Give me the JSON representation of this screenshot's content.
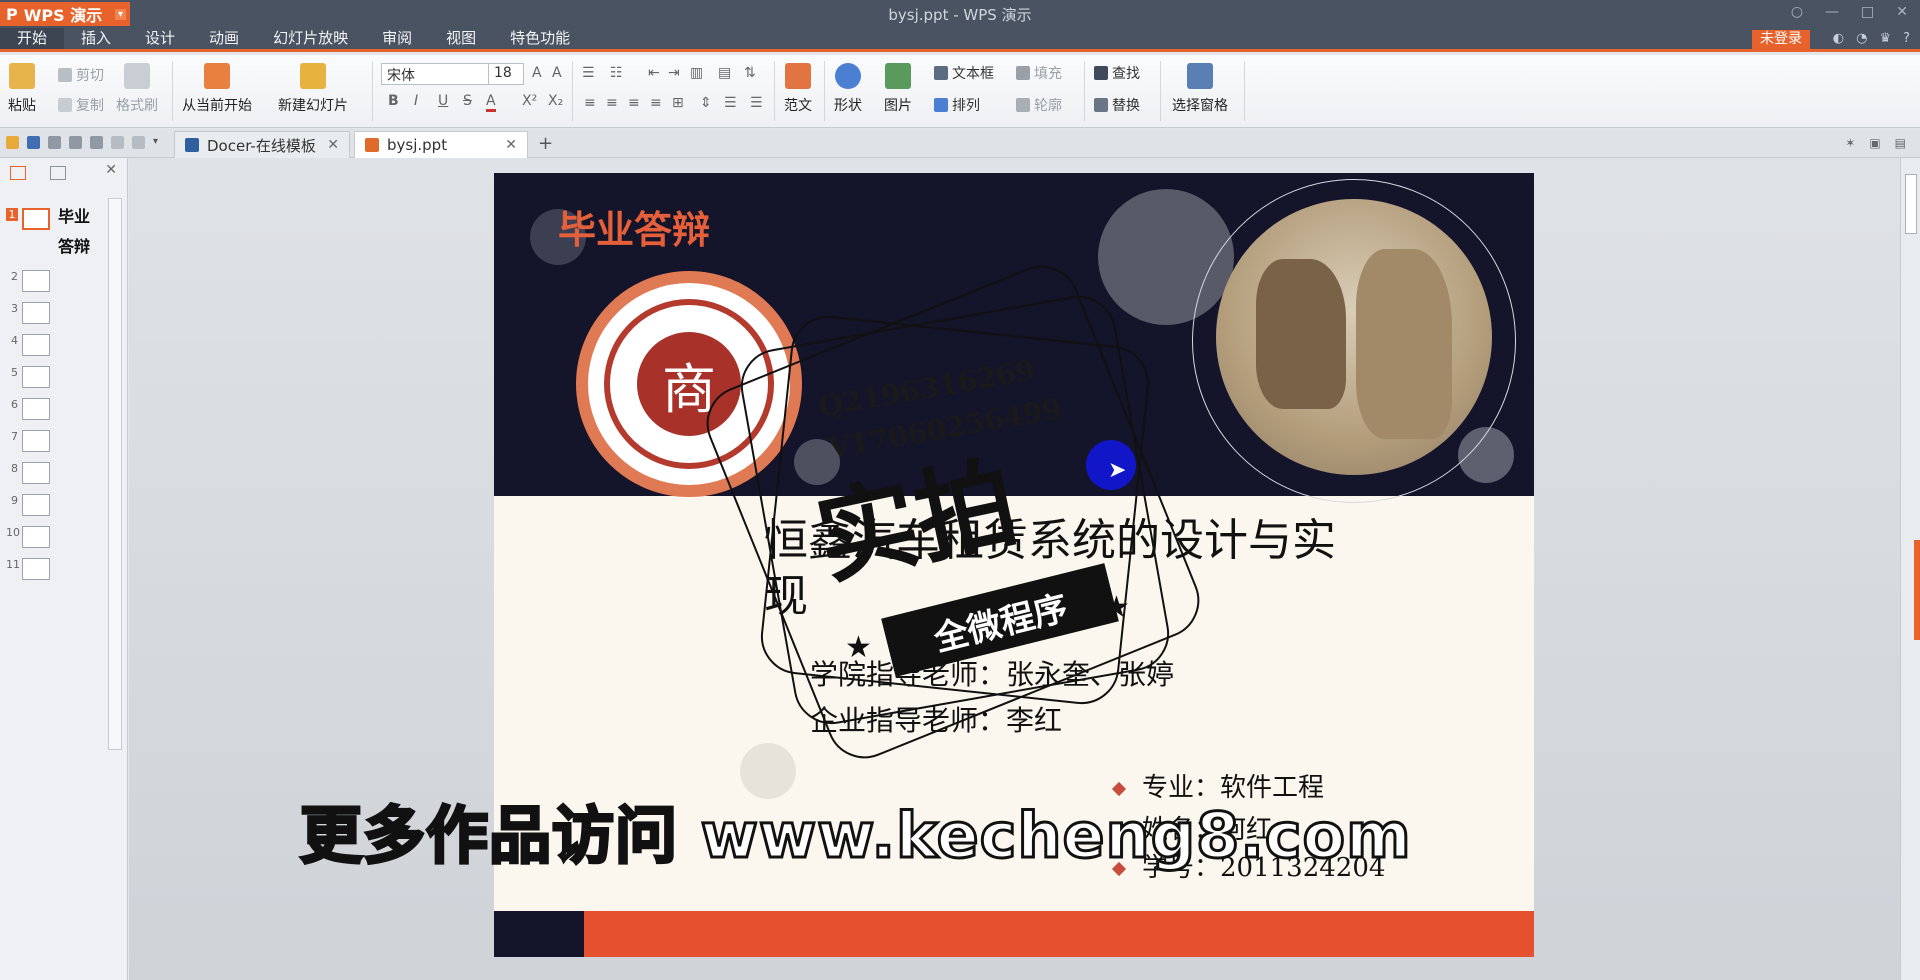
{
  "window": {
    "app_name": "WPS 演示",
    "title": "bysj.ppt - WPS 演示",
    "caret": "▾",
    "controls": [
      "○",
      "—",
      "□",
      "✕"
    ]
  },
  "menu": {
    "items": [
      "开始",
      "插入",
      "设计",
      "动画",
      "幻灯片放映",
      "审阅",
      "视图",
      "特色功能"
    ],
    "login": "未登录",
    "tools": [
      "◐",
      "◔",
      "♛",
      "?"
    ]
  },
  "ribbon": {
    "paste": "粘贴",
    "cut": "剪切",
    "copy": "复制",
    "format_painter": "格式刷",
    "from_current": "从当前开始",
    "new_slide": "新建幻灯片",
    "font_name": "宋体",
    "font_size": "18",
    "format_glyphs": [
      "B",
      "I",
      "U",
      "S",
      "A",
      "X²",
      "X₂"
    ],
    "template": "范文",
    "shapes": "形状",
    "picture": "图片",
    "textbox": "文本框",
    "fill": "填充",
    "arrange": "排列",
    "outline": "轮廓",
    "find": "查找",
    "replace": "替换",
    "selection_pane": "选择窗格"
  },
  "tabs": [
    {
      "label": "Docer-在线模板",
      "close": "✕"
    },
    {
      "label": "bysj.ppt",
      "close": "✕"
    }
  ],
  "add_tab": "+",
  "panel": {
    "close": "✕",
    "slides": [
      {
        "num": "1",
        "title": "毕业答辩"
      },
      {
        "num": "2"
      },
      {
        "num": "3"
      },
      {
        "num": "4"
      },
      {
        "num": "5"
      },
      {
        "num": "6"
      },
      {
        "num": "7"
      },
      {
        "num": "8"
      },
      {
        "num": "9"
      },
      {
        "num": "10"
      },
      {
        "num": "11"
      }
    ]
  },
  "slide": {
    "heading": "毕业答辩",
    "logo_char": "商",
    "title": "恒鑫汽车租赁系统的设计与实现",
    "advisor_college": "学院指导老师：张永奎、张婷",
    "advisor_company": "企业指导老师：李红",
    "major": "专业：软件工程",
    "name": "姓名：何红",
    "student_id": "学号：2011324204",
    "colors": {
      "navy": "#14142a",
      "orange": "#e5502e",
      "cream": "#fbf7ee",
      "heading": "#e5603a"
    }
  },
  "overlay": {
    "stamp_big": "实拍",
    "stamp_band": "全微程序",
    "contact_q": "Q2196316269",
    "contact_v": "V17060256499",
    "watermark": "更多作品访问 www.kecheng8.com",
    "cursor": "➤"
  }
}
